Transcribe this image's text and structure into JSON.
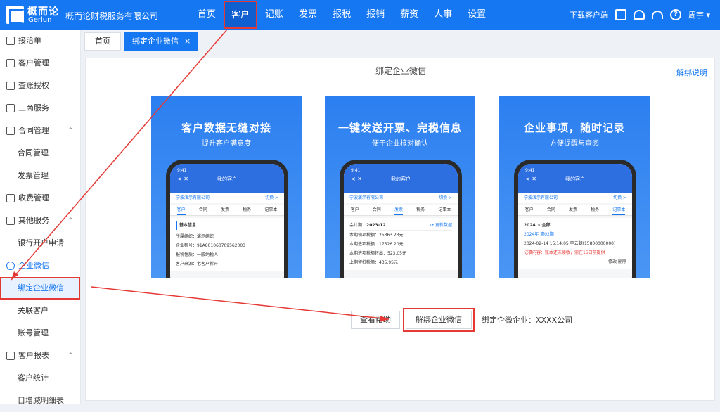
{
  "app": {
    "logo_cn": "概而论",
    "logo_en": "Gerlun",
    "company": "概而论财税服务有限公司"
  },
  "nav": [
    "首页",
    "客户",
    "记账",
    "发票",
    "报税",
    "报销",
    "薪资",
    "人事",
    "设置"
  ],
  "topright": {
    "download": "下载客户端",
    "user": "周宇 ▾"
  },
  "sidebar": [
    {
      "label": "接洽单",
      "icon": "document-icon"
    },
    {
      "label": "客户管理",
      "icon": "user-icon"
    },
    {
      "label": "查账授权",
      "icon": "user-key-icon"
    },
    {
      "label": "工商服务",
      "icon": "id-card-icon"
    },
    {
      "label": "合同管理",
      "icon": "contract-icon",
      "chev": "^"
    },
    {
      "label": "合同管理",
      "sub": true
    },
    {
      "label": "发票管理",
      "sub": true
    },
    {
      "label": "收费管理",
      "icon": "yen-icon"
    },
    {
      "label": "其他服务",
      "icon": "heart-icon",
      "chev": "^"
    },
    {
      "label": "银行开户申请",
      "sub": true
    },
    {
      "label": "企业微信",
      "icon": "wechat-icon",
      "blue": true
    },
    {
      "label": "绑定企业微信",
      "sub": true,
      "active": true
    },
    {
      "label": "关联客户",
      "sub": true
    },
    {
      "label": "账号管理",
      "sub": true
    },
    {
      "label": "客户报表",
      "icon": "chart-icon",
      "chev": "^"
    },
    {
      "label": "客户统计",
      "sub": true
    },
    {
      "label": "目增减明细表",
      "sub": true
    }
  ],
  "tabs": {
    "home": "首页",
    "current": "绑定企业微信",
    "close": "×"
  },
  "panel": {
    "title": "绑定企业微信",
    "help": "解绑说明"
  },
  "cards": [
    {
      "title": "客户数据无缝对接",
      "subtitle": "提升客户满意度"
    },
    {
      "title": "一键发送开票、完税信息",
      "subtitle": "便于企业核对确认"
    },
    {
      "title": "企业事项，随时记录",
      "subtitle": "方便提醒与查阅"
    }
  ],
  "phone": {
    "time": "9:41",
    "title": "我的客户",
    "company": "宁波演示有限公司",
    "switch": "切换 >",
    "tabs": [
      "客户",
      "合同",
      "发票",
      "税务",
      "记事本"
    ],
    "c1": {
      "section": "基本信息",
      "rows": [
        "所属组织：演示组织",
        "企业税号：91A801060709562003",
        "报税性质：一般纳税人",
        "客户来源：老客户新开"
      ]
    },
    "c2": {
      "period_label": "会计期：",
      "period": "2023-12",
      "update": "⟳ 更新数据",
      "rows": [
        "本期销项税额：25363.23元",
        "本期进项税额：17526.20元",
        "本期进项税额转出：523.05元",
        "上期留抵税额：435.95元"
      ]
    },
    "c3": {
      "year": "2024",
      "filter": "全部",
      "period": "2024年 第02期",
      "meta": "2024-02-14 15:14:05  李云朝(15800000000)",
      "content": "记事内容：账本还未接收，需在15日前提供",
      "edit": "修改  删除"
    }
  },
  "actions": {
    "view": "查看帮助",
    "unbind": "解绑企业微信",
    "bound_label": "绑定企微企业：",
    "bound_value": "XXXX公司"
  }
}
